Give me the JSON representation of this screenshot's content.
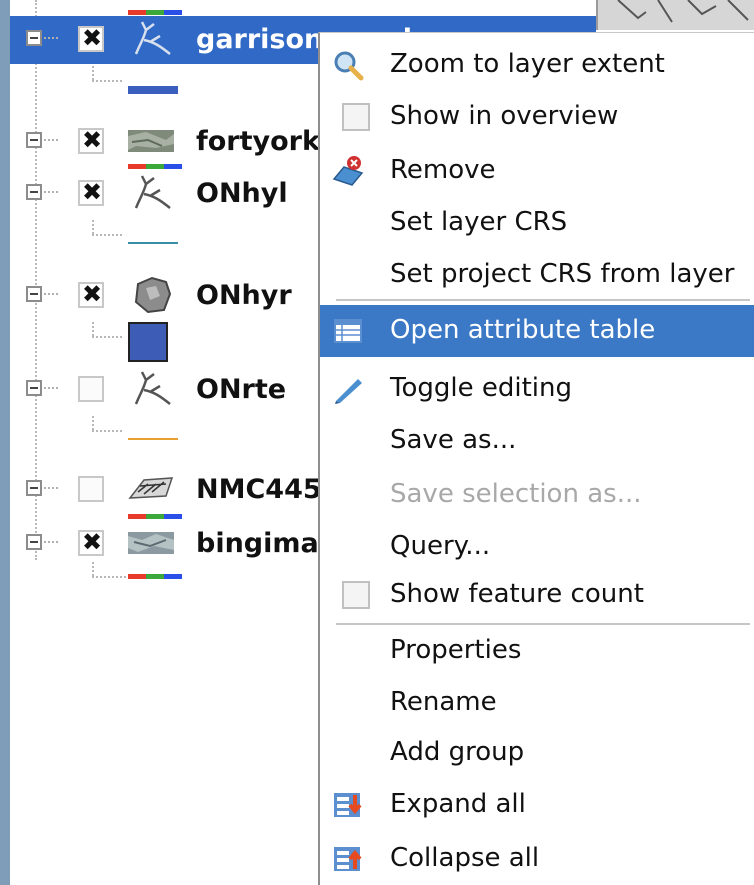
{
  "layers": [
    {
      "name": "garrison_creek",
      "checked": true,
      "selected": true,
      "icon": "line-layer-icon"
    },
    {
      "name": "fortyork",
      "checked": true,
      "selected": false,
      "icon": "raster-layer-icon"
    },
    {
      "name": "ONhyl",
      "checked": true,
      "selected": false,
      "icon": "line-layer-icon"
    },
    {
      "name": "ONhyr",
      "checked": true,
      "selected": false,
      "icon": "polygon-layer-icon"
    },
    {
      "name": "ONrte",
      "checked": false,
      "selected": false,
      "icon": "line-layer-icon"
    },
    {
      "name": "NMC445",
      "checked": false,
      "selected": false,
      "icon": "raster-map-icon"
    },
    {
      "name": "bingimage",
      "checked": true,
      "selected": false,
      "icon": "raster-layer-icon"
    }
  ],
  "checkmark_glyph": "✖",
  "legend_colors": {
    "garrison": "#3a5fbf",
    "onhyl": "#3a8fa8",
    "onhyr": "#3d5cb5",
    "onrte": "#e8a030",
    "rgb": [
      "#e83a2a",
      "#3aa83a",
      "#2a4fe8"
    ]
  },
  "context_menu": {
    "items": [
      {
        "label": "Zoom to layer extent",
        "icon": "zoom-icon",
        "type": "icon"
      },
      {
        "label": "Show in overview",
        "type": "check"
      },
      {
        "label": "Remove",
        "icon": "remove-icon",
        "type": "icon"
      },
      {
        "label": "Set layer CRS",
        "type": "plain"
      },
      {
        "label": "Set project CRS from layer",
        "type": "plain"
      },
      {
        "label": "Open attribute table",
        "icon": "table-icon",
        "type": "icon",
        "hover": true
      },
      {
        "label": "Toggle editing",
        "icon": "pencil-icon",
        "type": "icon"
      },
      {
        "label": "Save as...",
        "type": "plain"
      },
      {
        "label": "Save selection as...",
        "type": "plain",
        "disabled": true
      },
      {
        "label": "Query...",
        "type": "plain"
      },
      {
        "label": "Show feature count",
        "type": "check"
      },
      {
        "label": "Properties",
        "type": "plain"
      },
      {
        "label": "Rename",
        "type": "plain"
      },
      {
        "label": "Add group",
        "type": "plain"
      },
      {
        "label": "Expand all",
        "icon": "expand-all-icon",
        "type": "icon"
      },
      {
        "label": "Collapse all",
        "icon": "collapse-all-icon",
        "type": "icon"
      }
    ]
  },
  "colors": {
    "selection": "#3169c6",
    "menu_hover": "#3b78c6",
    "disabled_text": "#a8a8a8"
  }
}
